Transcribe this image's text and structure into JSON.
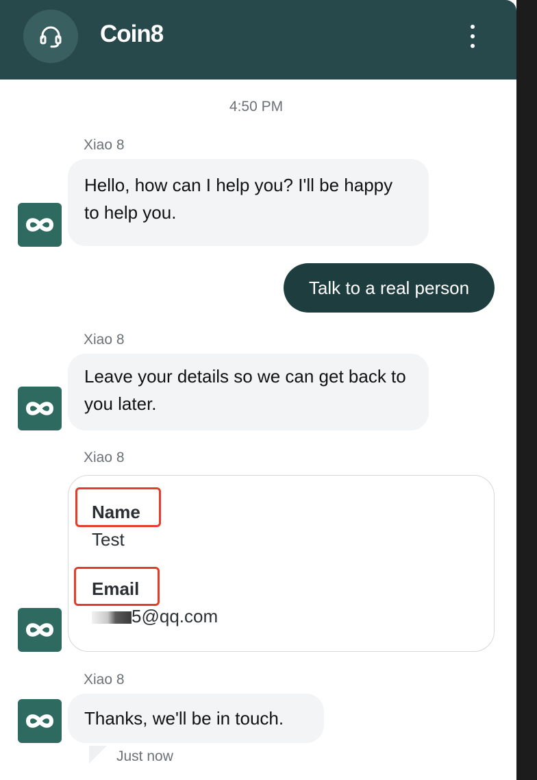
{
  "header": {
    "title": "Coin8",
    "avatar_icon": "headset-icon",
    "menu_icon": "kebab-menu-icon"
  },
  "timestamp": "4:50 PM",
  "messages": [
    {
      "sender": "Xiao 8",
      "text": "Hello, how can I help you? I'll be happy to help you."
    },
    {
      "text": "Talk to a real person"
    },
    {
      "sender": "Xiao 8",
      "text": "Leave your details so we can get back to you later."
    },
    {
      "sender": "Xiao 8",
      "form": {
        "name_label": "Name",
        "name_value": "Test",
        "email_label": "Email",
        "email_value_visible": "5@qq.com"
      }
    },
    {
      "sender": "Xiao 8",
      "text": "Thanks, we'll be in touch.",
      "status": "Just now"
    }
  ],
  "colors": {
    "header_bg": "#28494b",
    "user_bubble": "#1d3d3f",
    "bot_bubble": "#f3f4f6",
    "bot_avatar": "#2f6a61",
    "highlight": "#e23c2a"
  }
}
